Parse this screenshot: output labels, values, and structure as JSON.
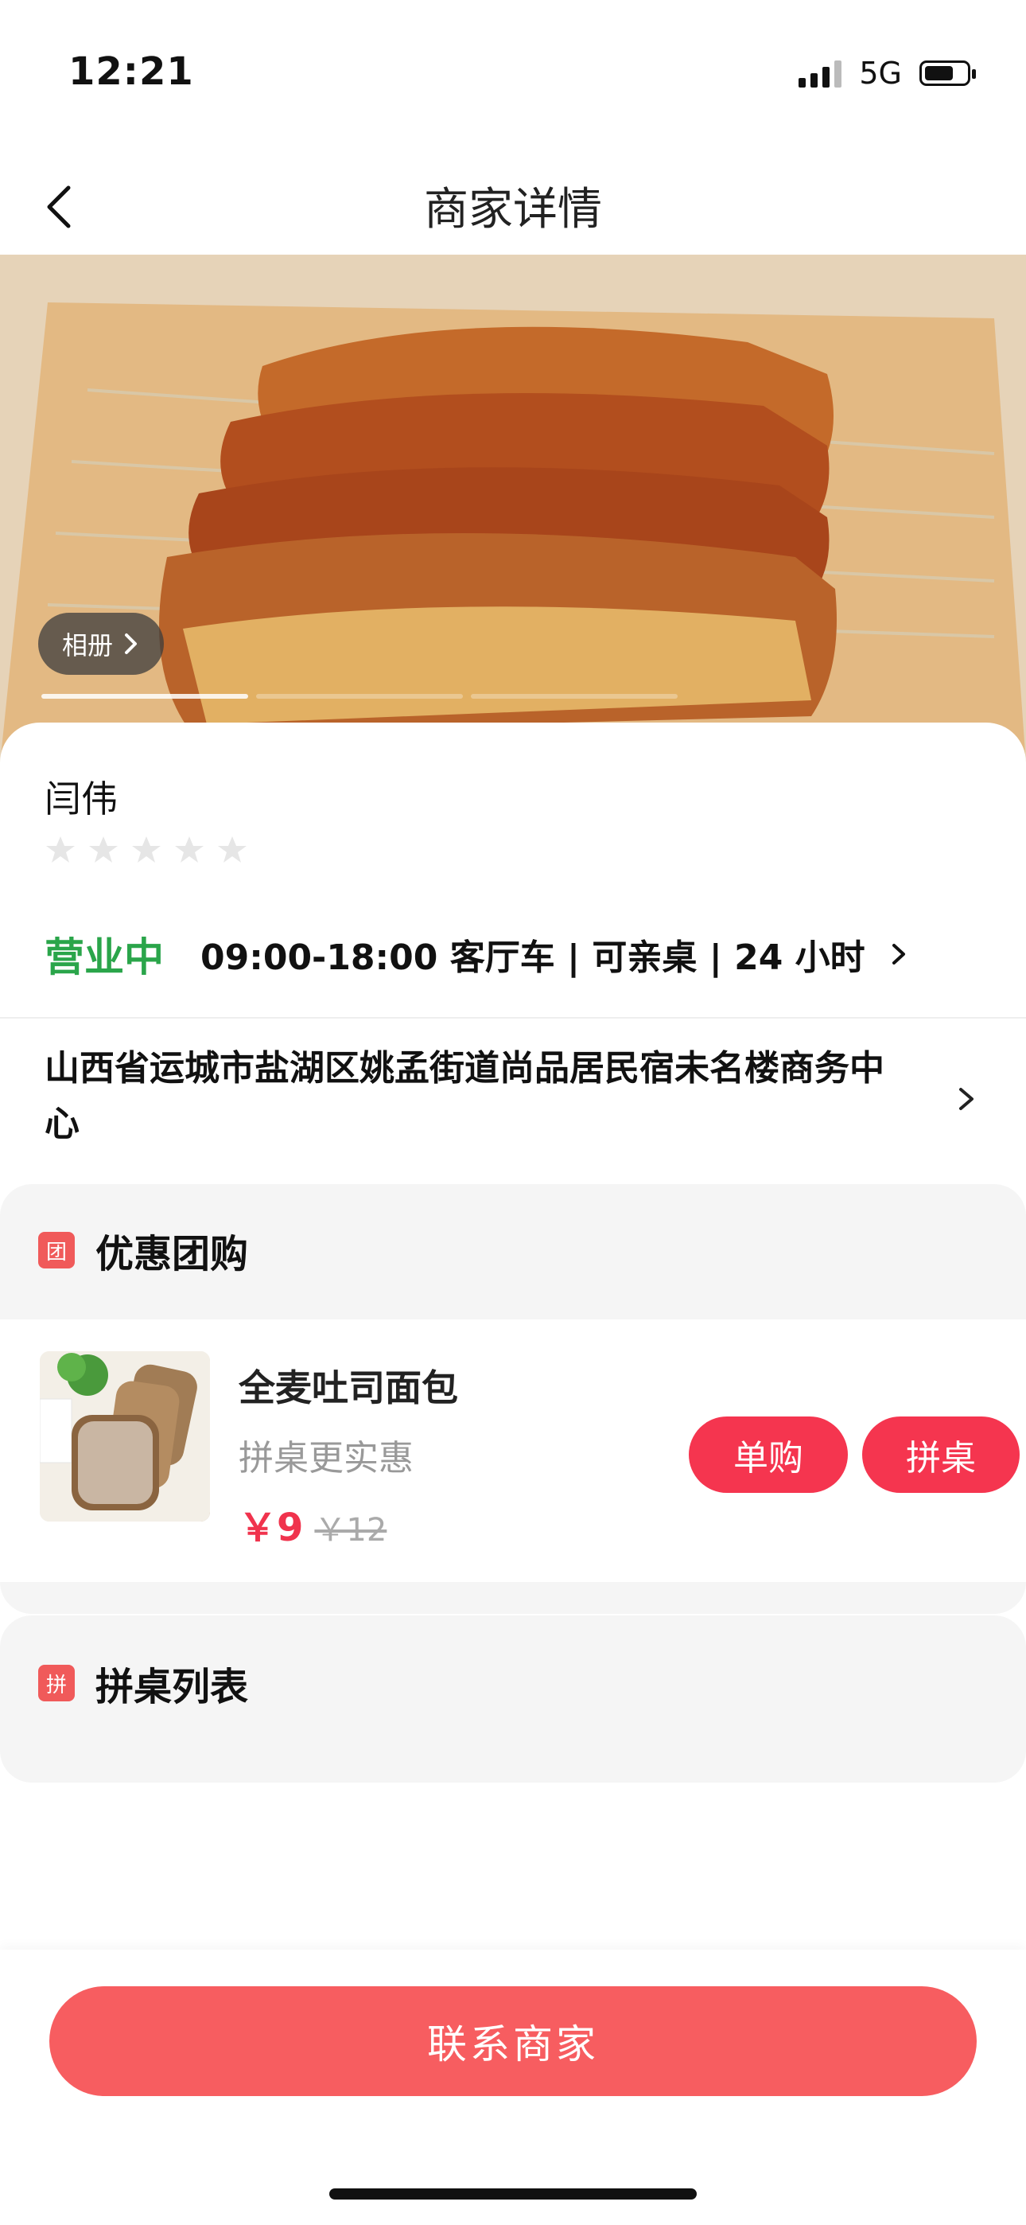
{
  "status_bar": {
    "time": "12:21",
    "network": "5G",
    "battery_percent": 70
  },
  "nav": {
    "title": "商家详情"
  },
  "hero": {
    "album_label": "相册",
    "slide_count": 3,
    "active_slide": 1
  },
  "merchant": {
    "name": "闫伟",
    "rating": 0,
    "max_rating": 5,
    "open_status": "营业中",
    "hours": "09:00-18:00 客厅车 | 可亲桌 | 24 小时",
    "address": "山西省运城市盐湖区姚孟街道尚品居民宿未名楼商务中心"
  },
  "group_buy": {
    "badge": "团",
    "title": "优惠团购",
    "item": {
      "name": "全麦吐司面包",
      "subtitle": "拼桌更实惠",
      "price": "￥9",
      "original_price": "￥12",
      "buy_single_label": "单购",
      "buy_group_label": "拼桌"
    }
  },
  "table_list": {
    "badge": "拼",
    "title": "拼桌列表"
  },
  "footer": {
    "contact_label": "联系商家"
  },
  "colors": {
    "accent_red": "#f5354f",
    "contact_red": "#f75d60",
    "open_green": "#2aa54a"
  }
}
